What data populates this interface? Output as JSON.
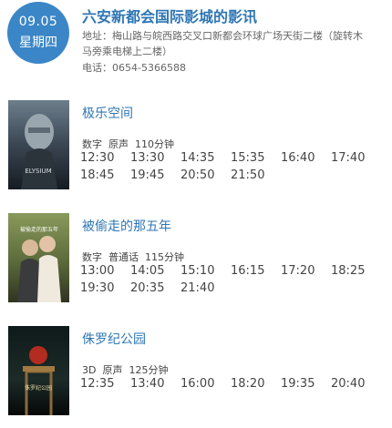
{
  "header": {
    "date": "09.05",
    "weekday": "星期四",
    "cinema_name": "六安新都会国际影城的影讯",
    "address": "地址：梅山路与皖西路交叉口新都会环球广场天街二楼（旋转木马旁乘电梯上二楼）",
    "phone": "电话：0654-5366588"
  },
  "movies": [
    {
      "title": "极乐空间",
      "format": "数字",
      "language": "原声",
      "duration": "110分钟",
      "showtimes": [
        "12:30",
        "13:30",
        "14:35",
        "15:35",
        "16:40",
        "17:40",
        "18:45",
        "19:45",
        "20:50",
        "21:50"
      ],
      "poster_text": "ELYSIUM"
    },
    {
      "title": "被偷走的那五年",
      "format": "数字",
      "language": "普通话",
      "duration": "115分钟",
      "showtimes": [
        "13:00",
        "14:05",
        "15:10",
        "16:15",
        "17:20",
        "18:25",
        "19:30",
        "20:35",
        "21:40"
      ],
      "poster_text": "被偷走的那五年"
    },
    {
      "title": "侏罗纪公园",
      "format": "3D",
      "language": "原声",
      "duration": "125分钟",
      "showtimes": [
        "12:35",
        "13:40",
        "16:00",
        "18:20",
        "19:35",
        "20:40"
      ],
      "poster_text": "侏罗纪公园"
    }
  ],
  "colors": {
    "accent": "#2e76b5",
    "badge": "#3b86c6"
  }
}
